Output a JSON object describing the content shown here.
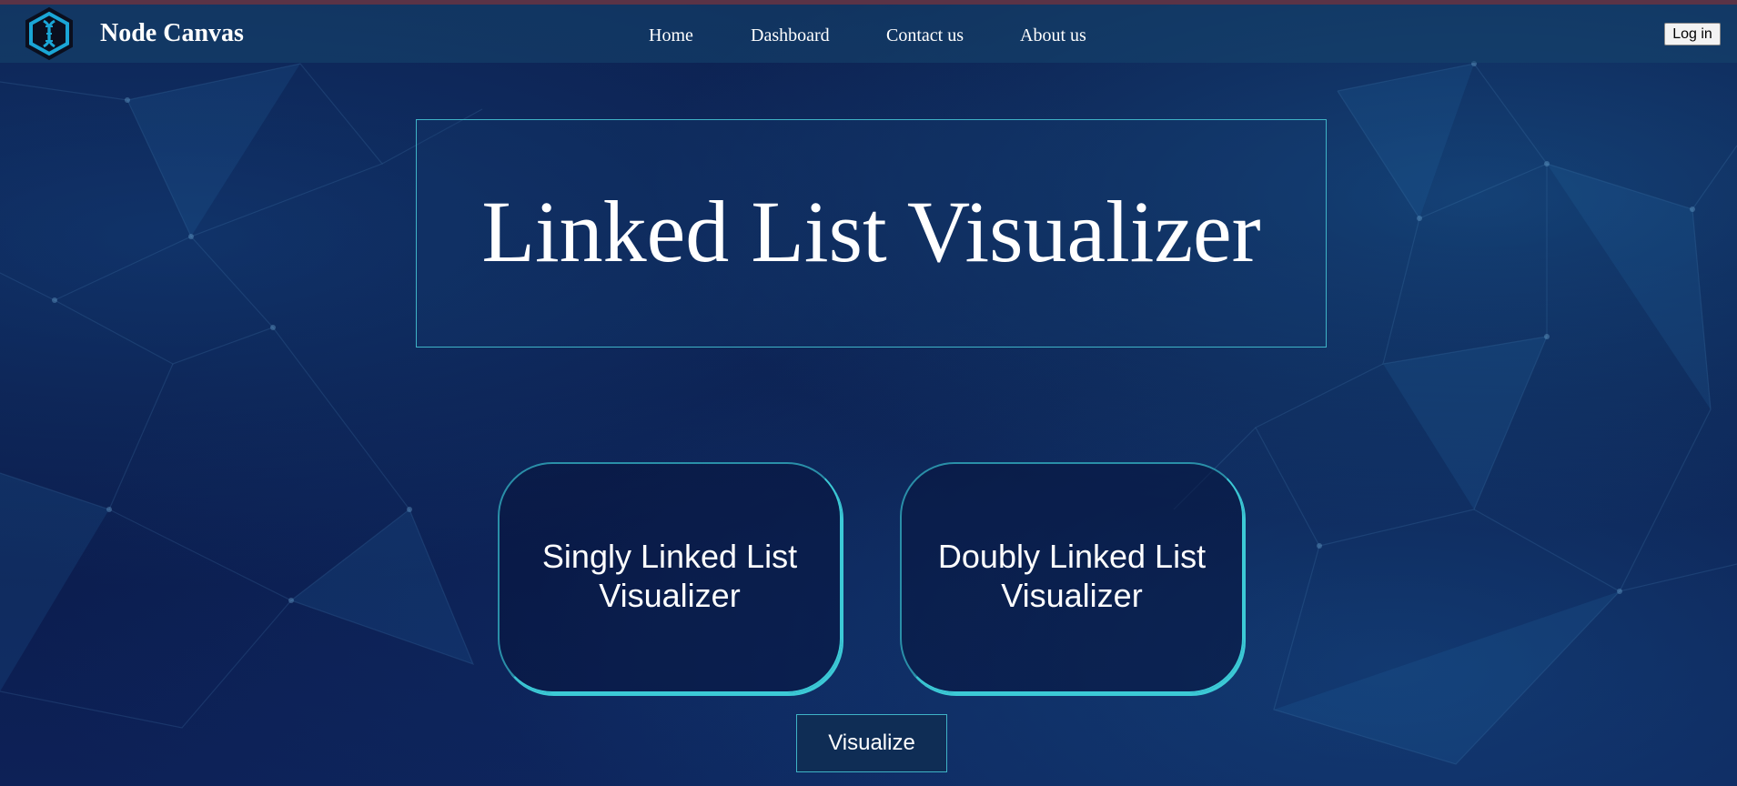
{
  "navbar": {
    "brand": "Node Canvas",
    "links": [
      {
        "label": "Home"
      },
      {
        "label": "Dashboard"
      },
      {
        "label": "Contact us"
      },
      {
        "label": "About us"
      }
    ],
    "login_label": "Log in"
  },
  "hero": {
    "title": "Linked List Visualizer"
  },
  "cards": [
    {
      "line1": "Singly Linked List",
      "line2": "Visualizer"
    },
    {
      "line1": "Doubly Linked List",
      "line2": "Visualizer"
    }
  ],
  "visualize_label": "Visualize",
  "colors": {
    "background": "#0b1a48",
    "accent": "#3ccad6",
    "navbar": "#16466e",
    "text": "#ffffff"
  },
  "icons": {
    "logo": "dna-hexagon-icon"
  }
}
